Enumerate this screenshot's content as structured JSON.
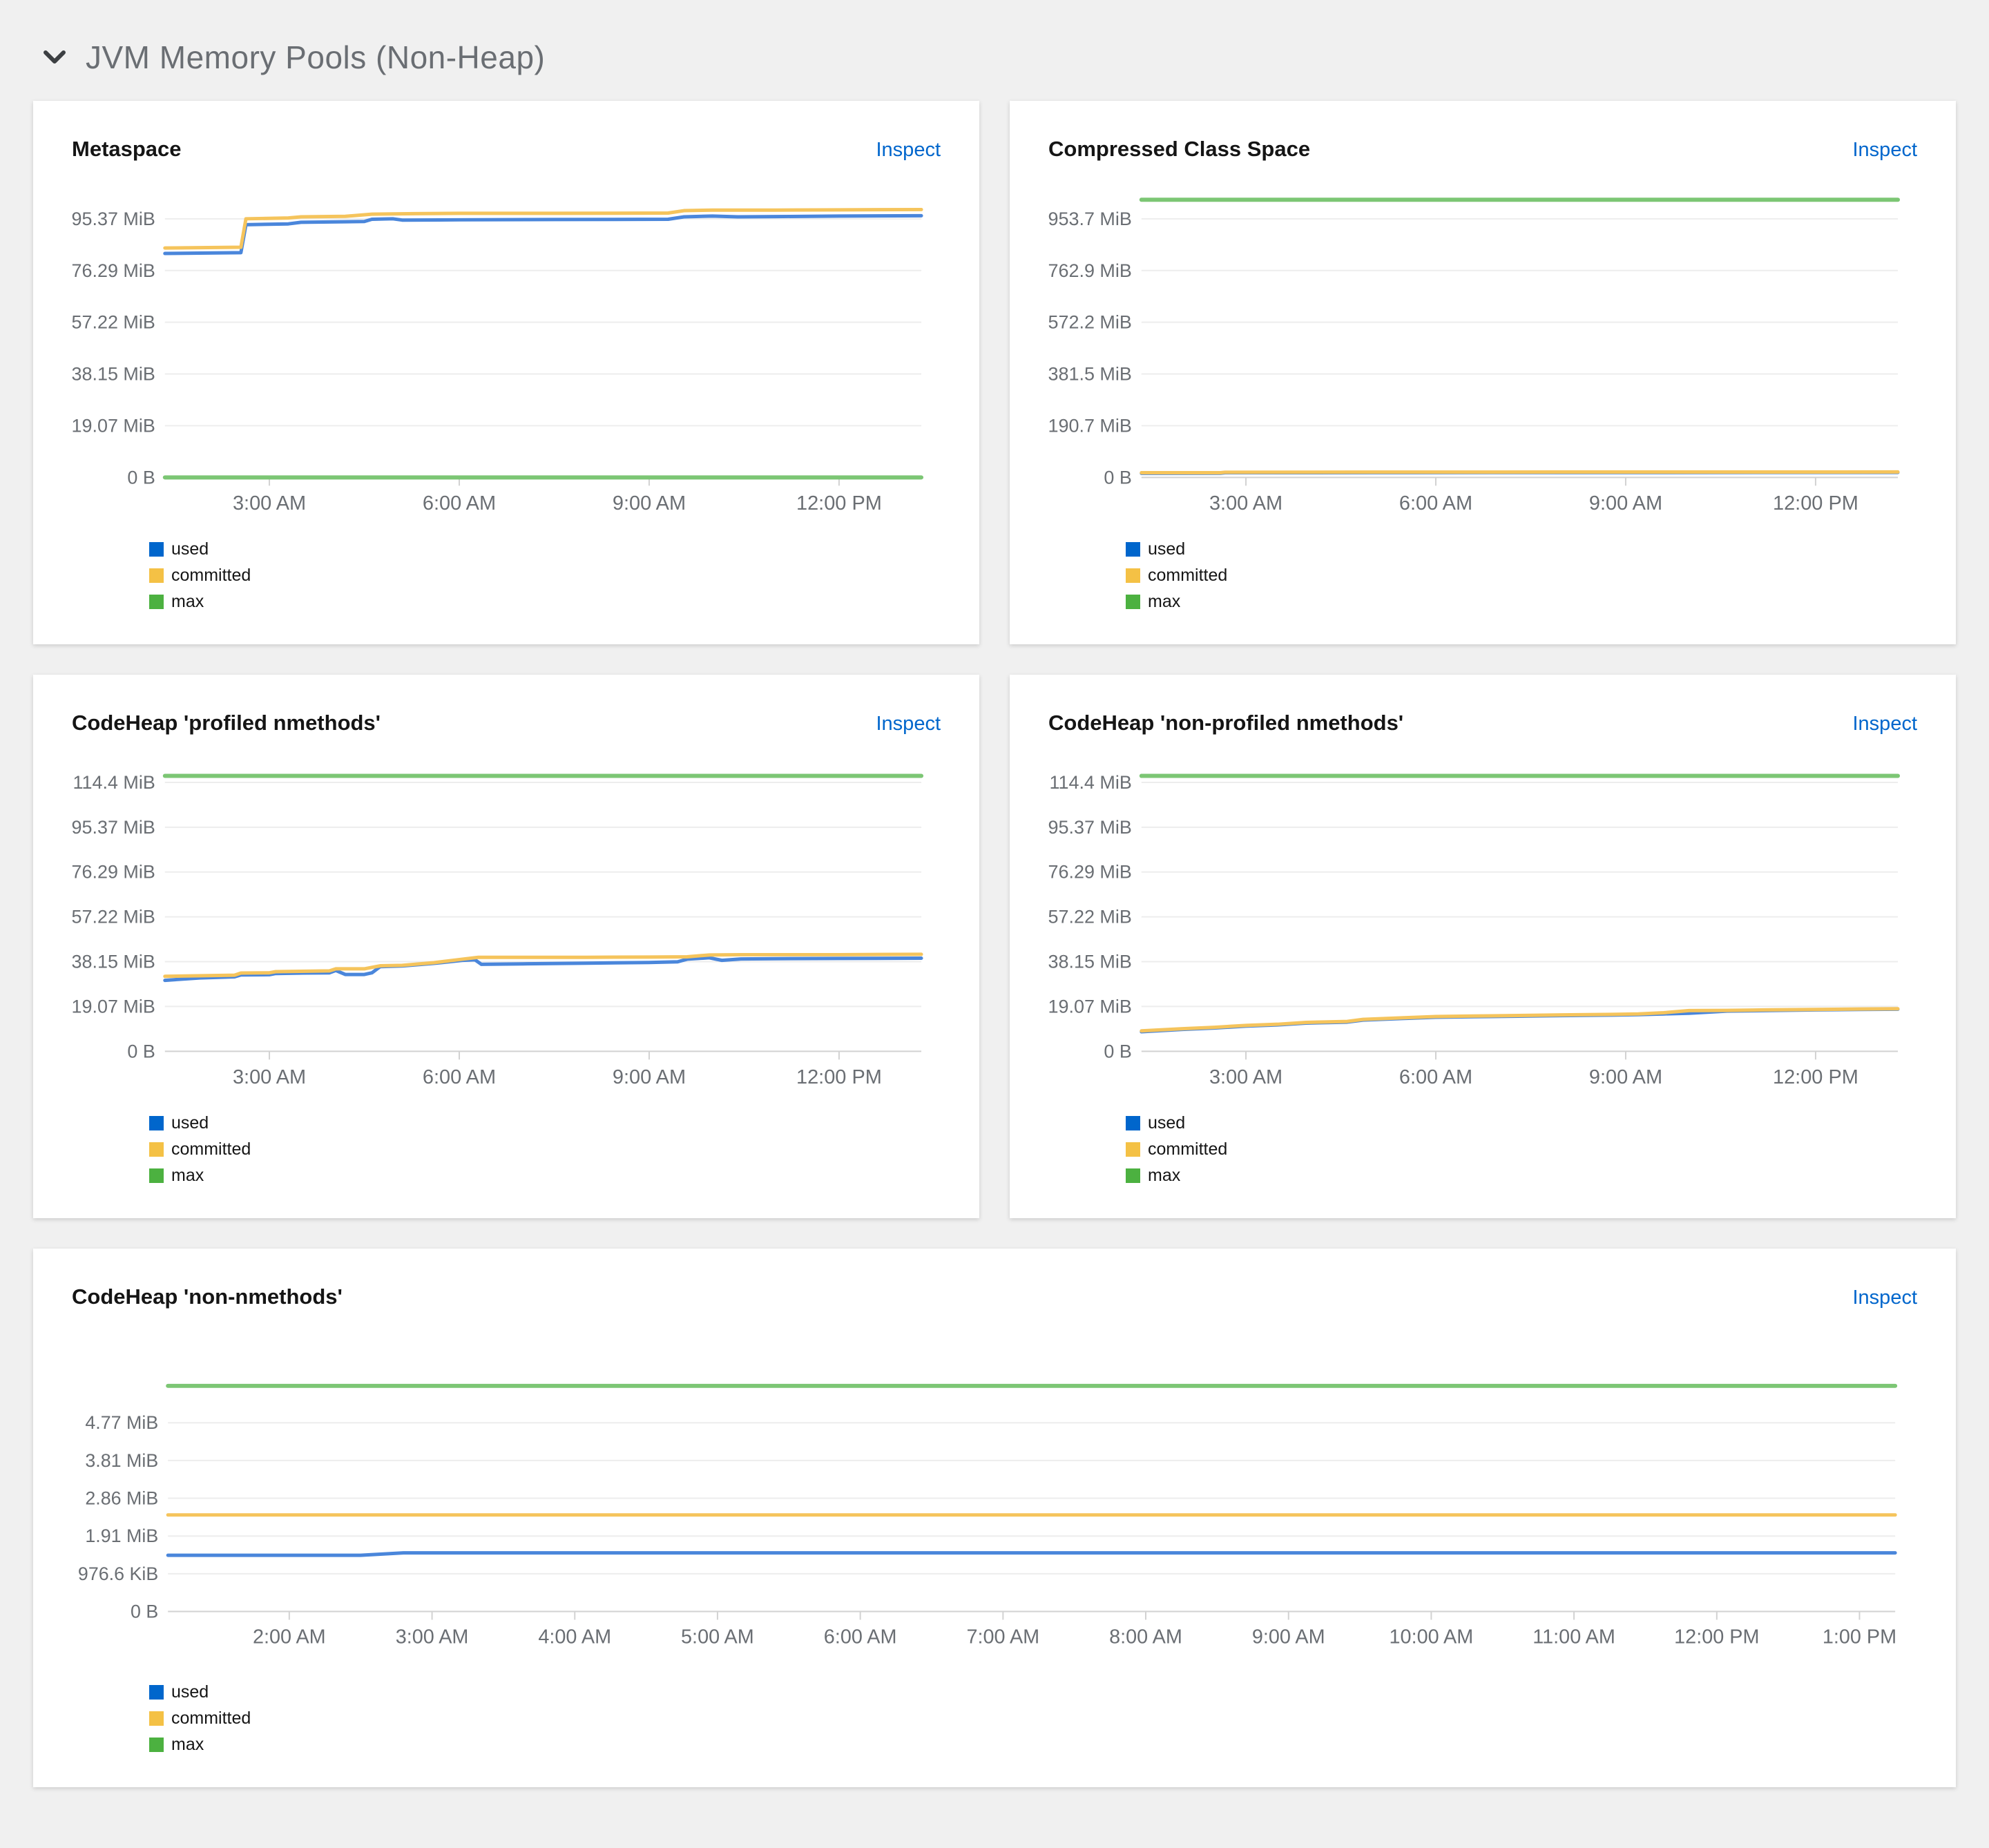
{
  "header": {
    "title": "JVM Memory Pools (Non-Heap)",
    "chevron_icon": "chevron-down"
  },
  "labels": {
    "inspect": "Inspect"
  },
  "legend_items": [
    {
      "name": "used"
    },
    {
      "name": "committed"
    },
    {
      "name": "max"
    }
  ],
  "palette": {
    "background": "#f0f0f0",
    "card": "#ffffff",
    "link": "#0066cc",
    "header_text": "#6a6e73",
    "title_text": "#151515",
    "tick_label": "#6a6e73",
    "grid": "#ededed",
    "axis": "#d2d2d2",
    "used": "#0066cc",
    "committed": "#f4c145",
    "max": "#4cb140",
    "line_used": "#4a86db",
    "line_committed": "#f5c45c",
    "line_max": "#7cc674"
  },
  "chart_data": [
    {
      "type": "line",
      "title": "Metaspace",
      "size": "half",
      "y_unit": 19.073,
      "y_ticks": [
        {
          "label": "0 B",
          "v": 0
        },
        {
          "label": "19.07 MiB",
          "v": 19.07
        },
        {
          "label": "38.15 MiB",
          "v": 38.15
        },
        {
          "label": "57.22 MiB",
          "v": 57.22
        },
        {
          "label": "76.29 MiB",
          "v": 76.29
        },
        {
          "label": "95.37 MiB",
          "v": 95.37
        }
      ],
      "x_domain": [
        1.35,
        13.3
      ],
      "x_ticks": [
        {
          "label": "3:00 AM",
          "h": 3
        },
        {
          "label": "6:00 AM",
          "h": 6
        },
        {
          "label": "9:00 AM",
          "h": 9
        },
        {
          "label": "12:00 PM",
          "h": 12
        }
      ],
      "series": {
        "used": [
          [
            1.35,
            82.6
          ],
          [
            2.55,
            82.9
          ],
          [
            2.63,
            93.2
          ],
          [
            3.3,
            93.5
          ],
          [
            3.5,
            94.1
          ],
          [
            4.2,
            94.3
          ],
          [
            4.5,
            94.4
          ],
          [
            4.62,
            95.2
          ],
          [
            4.95,
            95.4
          ],
          [
            5.1,
            94.9
          ],
          [
            6.0,
            95.0
          ],
          [
            7.5,
            95.1
          ],
          [
            9.3,
            95.2
          ],
          [
            9.55,
            96.1
          ],
          [
            10.0,
            96.4
          ],
          [
            10.4,
            96.1
          ],
          [
            11.0,
            96.2
          ],
          [
            12.0,
            96.4
          ],
          [
            13.3,
            96.5
          ]
        ],
        "committed": [
          [
            1.35,
            84.6
          ],
          [
            2.55,
            84.9
          ],
          [
            2.63,
            95.4
          ],
          [
            3.3,
            95.7
          ],
          [
            3.5,
            96.1
          ],
          [
            4.2,
            96.3
          ],
          [
            4.62,
            97.1
          ],
          [
            5.3,
            97.3
          ],
          [
            6.0,
            97.4
          ],
          [
            7.5,
            97.4
          ],
          [
            9.3,
            97.5
          ],
          [
            9.55,
            98.4
          ],
          [
            10.0,
            98.6
          ],
          [
            11.0,
            98.6
          ],
          [
            12.0,
            98.7
          ],
          [
            13.3,
            98.8
          ]
        ],
        "max": [
          [
            1.35,
            0
          ],
          [
            13.3,
            0
          ]
        ]
      }
    },
    {
      "type": "line",
      "title": "Compressed Class Space",
      "size": "half",
      "y_unit": 190.73,
      "y_ticks": [
        {
          "label": "0 B",
          "v": 0
        },
        {
          "label": "190.7 MiB",
          "v": 190.7
        },
        {
          "label": "381.5 MiB",
          "v": 381.5
        },
        {
          "label": "572.2 MiB",
          "v": 572.2
        },
        {
          "label": "762.9 MiB",
          "v": 762.9
        },
        {
          "label": "953.7 MiB",
          "v": 953.7
        }
      ],
      "x_domain": [
        1.35,
        13.3
      ],
      "x_ticks": [
        {
          "label": "3:00 AM",
          "h": 3
        },
        {
          "label": "6:00 AM",
          "h": 6
        },
        {
          "label": "9:00 AM",
          "h": 9
        },
        {
          "label": "12:00 PM",
          "h": 12
        }
      ],
      "series": {
        "used": [
          [
            1.35,
            15.3
          ],
          [
            2.6,
            15.6
          ],
          [
            2.67,
            17.2
          ],
          [
            5.0,
            17.6
          ],
          [
            8.0,
            18.0
          ],
          [
            13.3,
            18.4
          ]
        ],
        "committed": [
          [
            1.35,
            17.2
          ],
          [
            2.6,
            17.4
          ],
          [
            2.67,
            19.2
          ],
          [
            5.0,
            19.5
          ],
          [
            8.0,
            19.8
          ],
          [
            13.3,
            20.2
          ]
        ],
        "max": [
          [
            1.35,
            1024
          ],
          [
            13.3,
            1024
          ]
        ]
      }
    },
    {
      "type": "line",
      "title": "CodeHeap 'profiled nmethods'",
      "size": "half",
      "y_unit": 19.073,
      "y_ticks": [
        {
          "label": "0 B",
          "v": 0
        },
        {
          "label": "19.07 MiB",
          "v": 19.07
        },
        {
          "label": "38.15 MiB",
          "v": 38.15
        },
        {
          "label": "57.22 MiB",
          "v": 57.22
        },
        {
          "label": "76.29 MiB",
          "v": 76.29
        },
        {
          "label": "95.37 MiB",
          "v": 95.37
        },
        {
          "label": "114.4 MiB",
          "v": 114.4
        }
      ],
      "x_domain": [
        1.35,
        13.3
      ],
      "x_ticks": [
        {
          "label": "3:00 AM",
          "h": 3
        },
        {
          "label": "6:00 AM",
          "h": 6
        },
        {
          "label": "9:00 AM",
          "h": 9
        },
        {
          "label": "12:00 PM",
          "h": 12
        }
      ],
      "series": {
        "used": [
          [
            1.35,
            30.2
          ],
          [
            1.9,
            31.2
          ],
          [
            2.45,
            31.7
          ],
          [
            2.55,
            32.5
          ],
          [
            3.0,
            32.6
          ],
          [
            3.1,
            33.1
          ],
          [
            3.55,
            33.3
          ],
          [
            3.95,
            33.4
          ],
          [
            4.05,
            34.4
          ],
          [
            4.2,
            32.7
          ],
          [
            4.5,
            32.7
          ],
          [
            4.62,
            33.4
          ],
          [
            4.75,
            36.0
          ],
          [
            5.1,
            36.3
          ],
          [
            5.6,
            37.4
          ],
          [
            6.05,
            38.7
          ],
          [
            6.25,
            38.9
          ],
          [
            6.35,
            37.0
          ],
          [
            7.0,
            37.2
          ],
          [
            8.0,
            37.5
          ],
          [
            9.0,
            37.8
          ],
          [
            9.45,
            38.1
          ],
          [
            9.6,
            39.2
          ],
          [
            9.95,
            39.8
          ],
          [
            10.15,
            38.7
          ],
          [
            10.45,
            39.3
          ],
          [
            11.0,
            39.4
          ],
          [
            12.0,
            39.5
          ],
          [
            13.3,
            39.6
          ]
        ],
        "committed": [
          [
            1.35,
            31.9
          ],
          [
            2.45,
            32.4
          ],
          [
            2.55,
            33.3
          ],
          [
            3.0,
            33.4
          ],
          [
            3.1,
            33.9
          ],
          [
            3.95,
            34.2
          ],
          [
            4.05,
            35.1
          ],
          [
            4.5,
            35.1
          ],
          [
            4.75,
            36.4
          ],
          [
            5.1,
            36.6
          ],
          [
            5.6,
            37.7
          ],
          [
            6.05,
            39.2
          ],
          [
            6.3,
            40.0
          ],
          [
            7.0,
            40.0
          ],
          [
            8.0,
            40.0
          ],
          [
            9.0,
            40.1
          ],
          [
            9.6,
            40.2
          ],
          [
            9.95,
            41.0
          ],
          [
            10.45,
            41.1
          ],
          [
            12.0,
            41.1
          ],
          [
            13.3,
            41.3
          ]
        ],
        "max": [
          [
            1.35,
            117.2
          ],
          [
            13.3,
            117.2
          ]
        ]
      }
    },
    {
      "type": "line",
      "title": "CodeHeap 'non-profiled nmethods'",
      "size": "half",
      "y_unit": 19.073,
      "y_ticks": [
        {
          "label": "0 B",
          "v": 0
        },
        {
          "label": "19.07 MiB",
          "v": 19.07
        },
        {
          "label": "38.15 MiB",
          "v": 38.15
        },
        {
          "label": "57.22 MiB",
          "v": 57.22
        },
        {
          "label": "76.29 MiB",
          "v": 76.29
        },
        {
          "label": "95.37 MiB",
          "v": 95.37
        },
        {
          "label": "114.4 MiB",
          "v": 114.4
        }
      ],
      "x_domain": [
        1.35,
        13.3
      ],
      "x_ticks": [
        {
          "label": "3:00 AM",
          "h": 3
        },
        {
          "label": "6:00 AM",
          "h": 6
        },
        {
          "label": "9:00 AM",
          "h": 9
        },
        {
          "label": "12:00 PM",
          "h": 12
        }
      ],
      "series": {
        "used": [
          [
            1.35,
            8.3
          ],
          [
            2.0,
            9.3
          ],
          [
            2.5,
            9.9
          ],
          [
            3.0,
            10.7
          ],
          [
            3.5,
            11.2
          ],
          [
            3.95,
            12.0
          ],
          [
            4.3,
            12.2
          ],
          [
            4.6,
            12.4
          ],
          [
            4.85,
            13.3
          ],
          [
            5.5,
            14.0
          ],
          [
            6.0,
            14.5
          ],
          [
            6.6,
            14.7
          ],
          [
            7.2,
            14.9
          ],
          [
            8.0,
            15.2
          ],
          [
            8.8,
            15.4
          ],
          [
            9.2,
            15.6
          ],
          [
            9.6,
            15.9
          ],
          [
            10.0,
            16.2
          ],
          [
            10.6,
            17.1
          ],
          [
            11.2,
            17.3
          ],
          [
            12.0,
            17.6
          ],
          [
            12.7,
            17.8
          ],
          [
            13.3,
            17.9
          ]
        ],
        "committed": [
          [
            1.35,
            8.7
          ],
          [
            2.0,
            9.6
          ],
          [
            2.5,
            10.2
          ],
          [
            3.0,
            11.0
          ],
          [
            3.5,
            11.5
          ],
          [
            3.95,
            12.3
          ],
          [
            4.3,
            12.5
          ],
          [
            4.6,
            12.7
          ],
          [
            4.85,
            13.6
          ],
          [
            5.5,
            14.3
          ],
          [
            6.0,
            14.8
          ],
          [
            6.6,
            15.0
          ],
          [
            7.2,
            15.2
          ],
          [
            8.0,
            15.5
          ],
          [
            8.8,
            15.7
          ],
          [
            9.2,
            15.9
          ],
          [
            9.6,
            16.4
          ],
          [
            10.0,
            17.3
          ],
          [
            10.6,
            17.4
          ],
          [
            11.2,
            17.6
          ],
          [
            12.0,
            17.8
          ],
          [
            12.7,
            18.0
          ],
          [
            13.3,
            18.1
          ]
        ],
        "max": [
          [
            1.35,
            117.2
          ],
          [
            13.3,
            117.2
          ]
        ]
      }
    },
    {
      "type": "line",
      "title": "CodeHeap 'non-nmethods'",
      "size": "full",
      "y_unit": 0.9537,
      "y_ticks": [
        {
          "label": "0 B",
          "v": 0
        },
        {
          "label": "976.6 KiB",
          "v": 0.9537
        },
        {
          "label": "1.91 MiB",
          "v": 1.907
        },
        {
          "label": "2.86 MiB",
          "v": 2.861
        },
        {
          "label": "3.81 MiB",
          "v": 3.815
        },
        {
          "label": "4.77 MiB",
          "v": 4.768
        }
      ],
      "x_domain": [
        1.15,
        13.25
      ],
      "x_ticks": [
        {
          "label": "2:00 AM",
          "h": 2
        },
        {
          "label": "3:00 AM",
          "h": 3
        },
        {
          "label": "4:00 AM",
          "h": 4
        },
        {
          "label": "5:00 AM",
          "h": 5
        },
        {
          "label": "6:00 AM",
          "h": 6
        },
        {
          "label": "7:00 AM",
          "h": 7
        },
        {
          "label": "8:00 AM",
          "h": 8
        },
        {
          "label": "9:00 AM",
          "h": 9
        },
        {
          "label": "10:00 AM",
          "h": 10
        },
        {
          "label": "11:00 AM",
          "h": 11
        },
        {
          "label": "12:00 PM",
          "h": 12
        },
        {
          "label": "1:00 PM",
          "h": 13
        }
      ],
      "series": {
        "used": [
          [
            1.15,
            1.42
          ],
          [
            2.5,
            1.42
          ],
          [
            2.8,
            1.48
          ],
          [
            13.25,
            1.48
          ]
        ],
        "committed": [
          [
            1.15,
            2.44
          ],
          [
            13.25,
            2.44
          ]
        ],
        "max": [
          [
            1.15,
            5.7
          ],
          [
            13.25,
            5.7
          ]
        ]
      }
    }
  ]
}
